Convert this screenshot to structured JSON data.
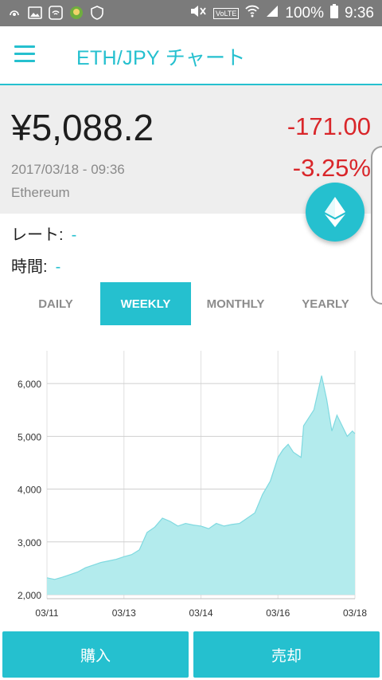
{
  "status_bar": {
    "battery": "100%",
    "time": "9:36",
    "lte_label": "VoLTE"
  },
  "app_bar": {
    "title": "ETH/JPY チャート",
    "menu_icon": "hamburger-icon"
  },
  "summary": {
    "price": "¥5,088.2",
    "change": "-171.00",
    "change_percent": "-3.25%",
    "timestamp": "2017/03/18 - 09:36",
    "coin_name": "Ethereum",
    "fab_icon": "ethereum-icon",
    "change_color": "#d9262a"
  },
  "info": {
    "rate_label": "レート:",
    "rate_value": "-",
    "time_label": "時間:",
    "time_value": "-"
  },
  "tabs": [
    {
      "label": "DAILY",
      "active": false
    },
    {
      "label": "WEEKLY",
      "active": true
    },
    {
      "label": "MONTHLY",
      "active": false
    },
    {
      "label": "YEARLY",
      "active": false
    }
  ],
  "chart_data": {
    "type": "area",
    "ylim": [
      2000,
      6500
    ],
    "yticks": [
      "6,000",
      "5,000",
      "4,000",
      "3,000",
      "2,000"
    ],
    "ytick_values": [
      6000,
      5000,
      4000,
      3000,
      2000
    ],
    "xticks": [
      "03/11",
      "03/13",
      "03/14",
      "03/16",
      "03/18"
    ],
    "xtick_days": [
      0,
      1.5,
      3,
      4.5,
      6
    ],
    "grid": true,
    "fill_color": "#b3ebed",
    "line_color": "#7fd9e0",
    "x": [
      0,
      0.15,
      0.3,
      0.45,
      0.6,
      0.75,
      0.9,
      1.05,
      1.2,
      1.35,
      1.5,
      1.65,
      1.8,
      1.95,
      2.1,
      2.25,
      2.4,
      2.55,
      2.7,
      2.85,
      3.0,
      3.15,
      3.3,
      3.45,
      3.6,
      3.75,
      3.9,
      4.05,
      4.2,
      4.35,
      4.5,
      4.6,
      4.7,
      4.8,
      4.95,
      5.0,
      5.1,
      5.2,
      5.35,
      5.45,
      5.55,
      5.65,
      5.75,
      5.85,
      5.95,
      6.0
    ],
    "y": [
      2320,
      2290,
      2330,
      2380,
      2430,
      2510,
      2560,
      2610,
      2640,
      2670,
      2720,
      2760,
      2850,
      3180,
      3280,
      3450,
      3390,
      3300,
      3350,
      3320,
      3300,
      3250,
      3350,
      3300,
      3330,
      3350,
      3450,
      3550,
      3900,
      4150,
      4600,
      4750,
      4850,
      4700,
      4600,
      5200,
      5350,
      5500,
      6150,
      5700,
      5100,
      5400,
      5200,
      5000,
      5100,
      5050
    ]
  },
  "actions": {
    "buy_label": "購入",
    "sell_label": "売却"
  }
}
